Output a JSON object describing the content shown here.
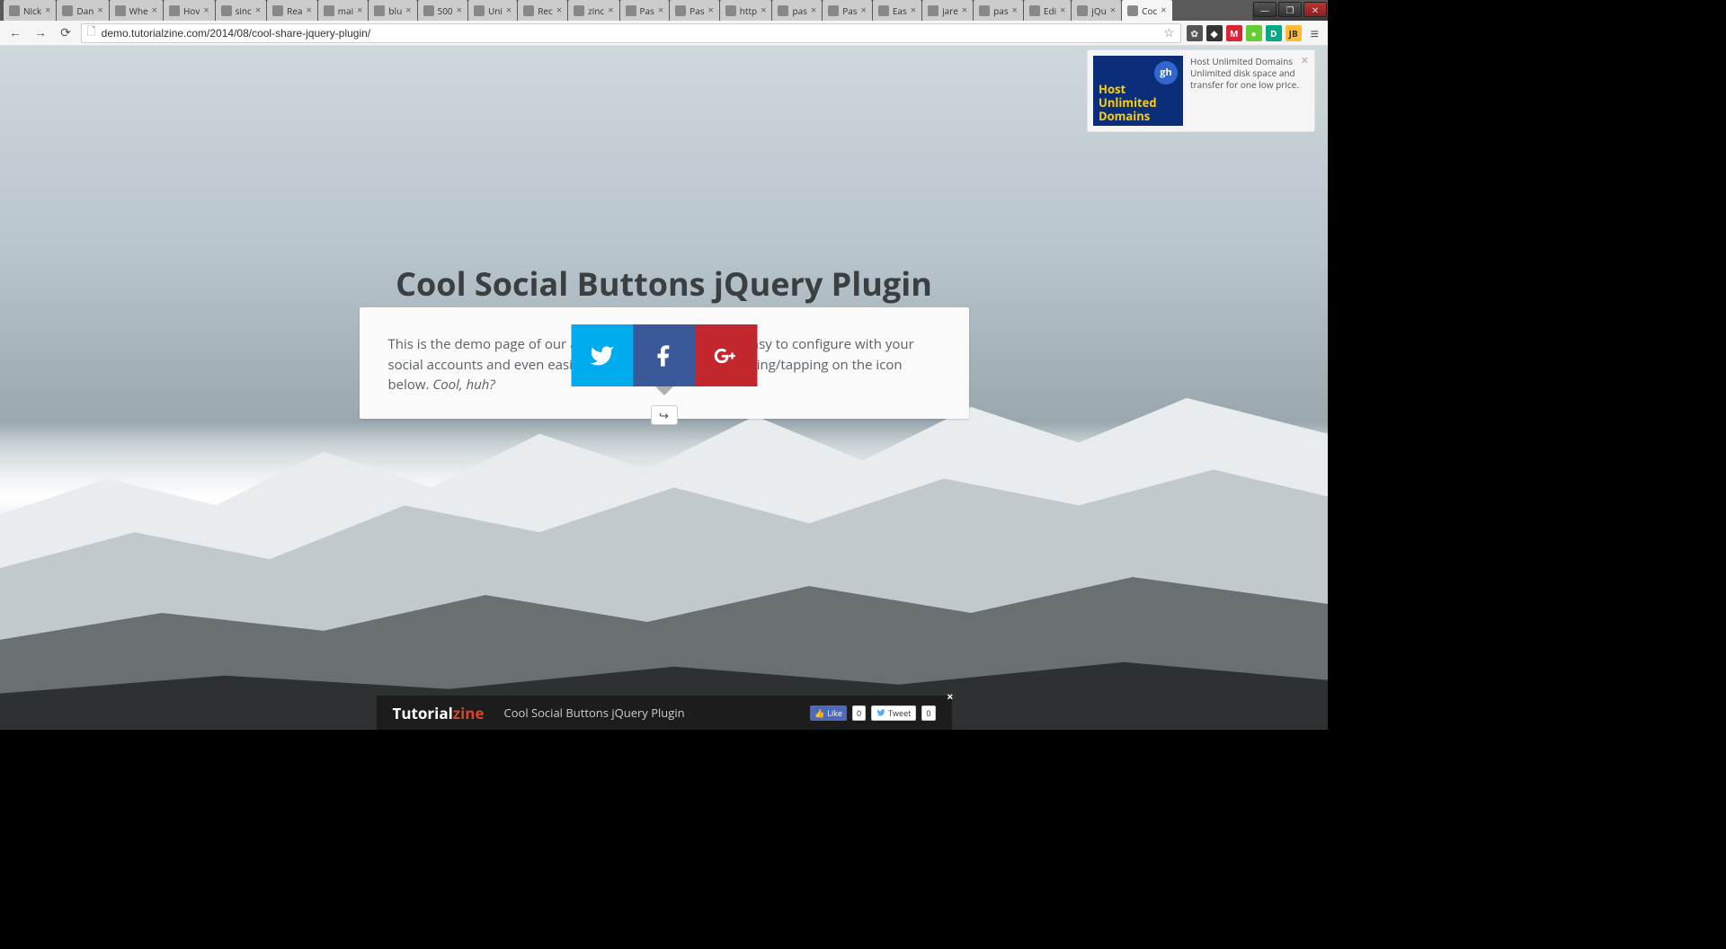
{
  "browser": {
    "url": "demo.tutorialzine.com/2014/08/cool-share-jquery-plugin/",
    "tabs": [
      {
        "label": "Nick"
      },
      {
        "label": "Dan"
      },
      {
        "label": "Whe"
      },
      {
        "label": "Hov"
      },
      {
        "label": "sinc"
      },
      {
        "label": "Rea"
      },
      {
        "label": "mai"
      },
      {
        "label": "blu"
      },
      {
        "label": "500"
      },
      {
        "label": "Uni"
      },
      {
        "label": "Rec"
      },
      {
        "label": "zinc"
      },
      {
        "label": "Pas"
      },
      {
        "label": "Pas"
      },
      {
        "label": "http"
      },
      {
        "label": "pas"
      },
      {
        "label": "Pas"
      },
      {
        "label": "Eas"
      },
      {
        "label": "jare"
      },
      {
        "label": "pas"
      },
      {
        "label": "Edi"
      },
      {
        "label": "jQu"
      },
      {
        "label": "Coc",
        "active": true
      }
    ],
    "extensions": [
      {
        "bg": "#555",
        "fg": "#ddd",
        "glyph": "✿"
      },
      {
        "bg": "#333",
        "fg": "#fff",
        "glyph": "◆"
      },
      {
        "bg": "#d23",
        "fg": "#fff",
        "glyph": "M"
      },
      {
        "bg": "#6c3",
        "fg": "#fff",
        "glyph": "●"
      },
      {
        "bg": "#0a8",
        "fg": "#fff",
        "glyph": "D"
      },
      {
        "bg": "#fb3",
        "fg": "#333",
        "glyph": "JB"
      }
    ]
  },
  "page": {
    "title": "Cool Social Buttons jQuery Plugin",
    "card": {
      "text_before": "This is the demo page of our aw",
      "text_mid": "is easy to configure with your social accounts and even easier",
      "text_after": ". Try it by clicking/tapping on the icon below. ",
      "text_em": "Cool, huh?"
    },
    "share": {
      "twitter": "Twitter",
      "facebook": "Facebook",
      "googleplus": "Google+"
    }
  },
  "ad": {
    "headline1": "Host",
    "headline2": "Unlimited",
    "headline3": "Domains",
    "badge": "gh",
    "text": "Host Unlimited Domains Unlimited disk space and transfer for one low price."
  },
  "bottombar": {
    "brand1": "Tutorial",
    "brand2": "zine",
    "title": "Cool Social Buttons jQuery Plugin",
    "like_label": "Like",
    "like_count": "0",
    "tweet_label": "Tweet",
    "tweet_count": "0"
  }
}
